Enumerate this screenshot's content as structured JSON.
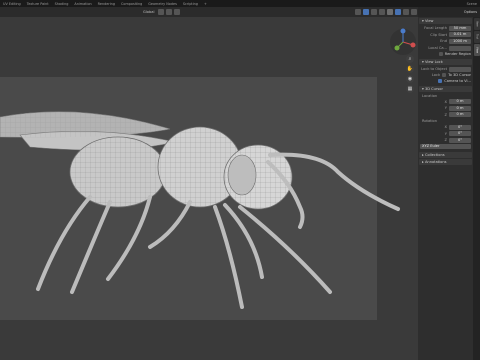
{
  "topbar": {
    "tabs": [
      "UV Editing",
      "Texture Paint",
      "Shading",
      "Animation",
      "Rendering",
      "Compositing",
      "Geometry Nodes",
      "Scripting",
      "+"
    ],
    "scene": "Scene"
  },
  "viewport_header": {
    "transform": "Global",
    "snap": "",
    "proportional": ""
  },
  "nav_gizmo": {
    "x": "X",
    "y": "Y",
    "z": "Z"
  },
  "npanel": {
    "options_label": "Options",
    "view": {
      "title": "View",
      "focal_label": "Focal Length",
      "focal_value": "50 mm",
      "clip_start_label": "Clip Start",
      "clip_start_value": "0.01 m",
      "clip_end_label": "End",
      "clip_end_value": "1000 m",
      "local_cam_label": "Local Ca...",
      "render_region": "Render Region"
    },
    "view_lock": {
      "title": "View Lock",
      "lock_to_object": "Lock to Object",
      "lock_label": "Lock",
      "to_3d_cursor": "To 3D Cursor",
      "camera_to_view": "Camera to Vi..."
    },
    "cursor": {
      "title": "3D Cursor",
      "location_label": "Location",
      "x": "0 m",
      "y": "0 m",
      "z": "0 m",
      "rotation_label": "Rotation",
      "rx": "0°",
      "ry": "0°",
      "rz": "0°",
      "rotation_mode": "XYZ Euler"
    },
    "collections_title": "Collections",
    "annotations_title": "Annotations"
  },
  "side_tabs": [
    "Item",
    "Tool",
    "View"
  ]
}
